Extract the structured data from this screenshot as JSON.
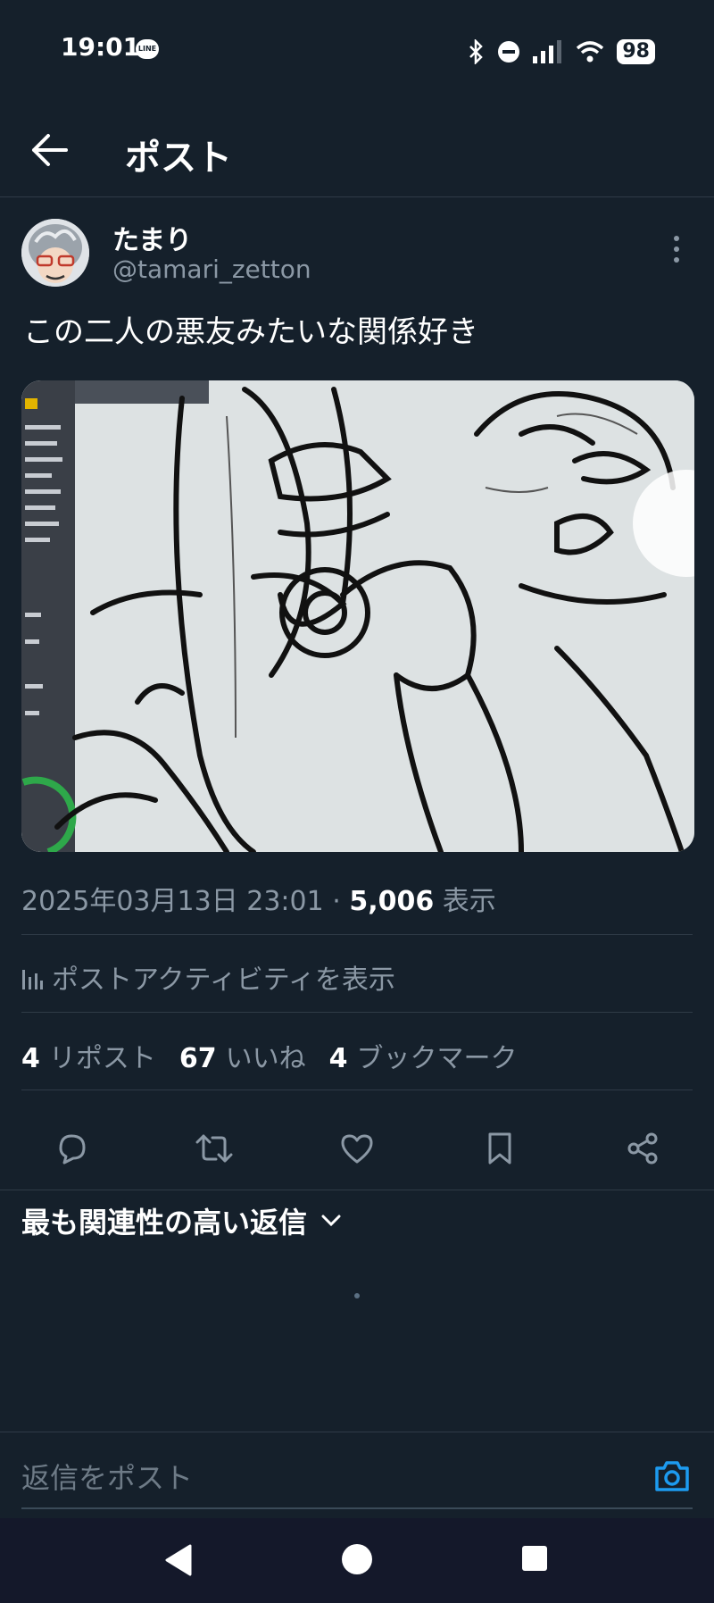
{
  "status_bar": {
    "time": "19:01",
    "line_label": "LINE",
    "battery": "98"
  },
  "header": {
    "title": "ポスト"
  },
  "post": {
    "author_name": "たまり",
    "author_handle": "@tamari_zetton",
    "text": "この二人の悪友みたいな関係好き",
    "timestamp": "2025年03月13日 23:01",
    "separator": "·",
    "views_count": "5,006",
    "views_label": "表示"
  },
  "activity": {
    "label": "ポストアクティビティを表示"
  },
  "stats": {
    "reposts_count": "4",
    "reposts_label": "リポスト",
    "likes_count": "67",
    "likes_label": "いいね",
    "bookmarks_count": "4",
    "bookmarks_label": "ブックマーク"
  },
  "replies": {
    "sort_label": "最も関連性の高い返信"
  },
  "reply_box": {
    "placeholder": "返信をポスト"
  },
  "colors": {
    "background": "#15202b",
    "accent": "#1d9bf0",
    "muted": "#8b98a5"
  },
  "icons": [
    "back-arrow-icon",
    "more-icon",
    "chart-icon",
    "reply-icon",
    "retweet-icon",
    "like-icon",
    "bookmark-icon",
    "share-icon",
    "chevron-down-icon",
    "camera-icon",
    "nav-back-icon",
    "nav-home-icon",
    "nav-recents-icon"
  ]
}
